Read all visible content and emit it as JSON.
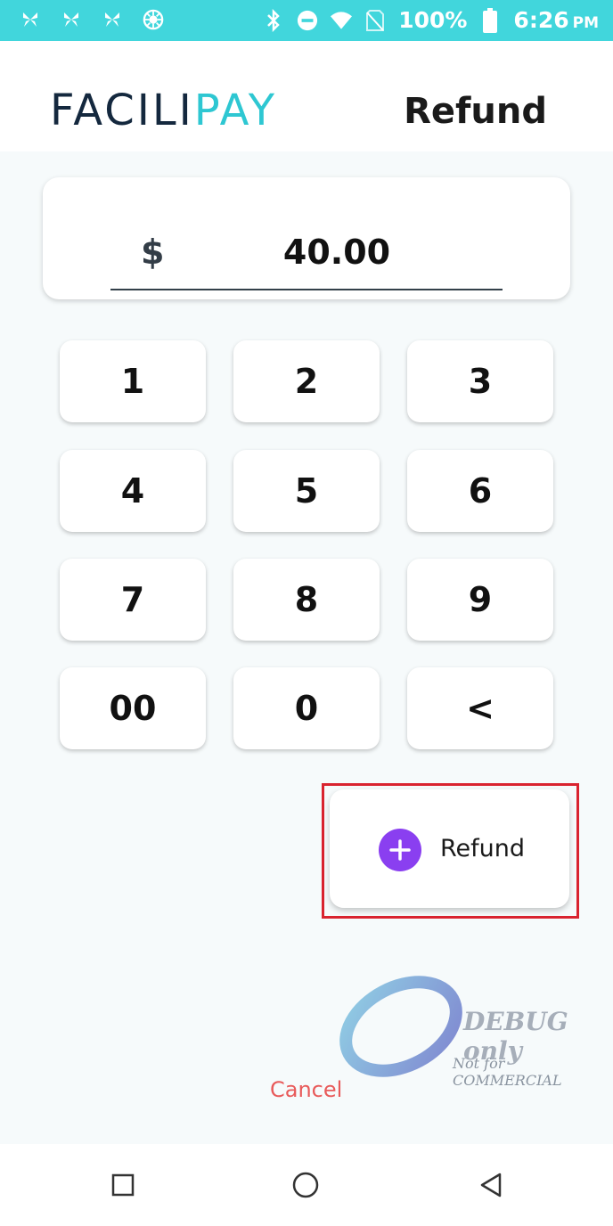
{
  "status_bar": {
    "battery": "100%",
    "time": "6:26",
    "ampm": "PM",
    "left_icons": [
      "butterfly-icon",
      "butterfly-icon",
      "butterfly-icon",
      "aperture-icon"
    ],
    "right_icons": [
      "bluetooth-icon",
      "do-not-disturb-icon",
      "wifi-icon",
      "no-sim-icon",
      "battery-icon"
    ],
    "bg_color": "#41d6dc"
  },
  "header": {
    "logo_part1": "FACILI",
    "logo_part2": "PAY",
    "title": "Refund"
  },
  "amount": {
    "currency": "$",
    "value": "40.00"
  },
  "keypad": [
    "1",
    "2",
    "3",
    "4",
    "5",
    "6",
    "7",
    "8",
    "9",
    "00",
    "0",
    "<"
  ],
  "refund_button": {
    "icon": "plus-icon",
    "label": "Refund",
    "accent": "#8a3ff0"
  },
  "cancel_label": "Cancel",
  "watermark": {
    "line1": "DEBUG only",
    "line2": "Not for COMMERCIAL"
  },
  "nav": [
    "recents-icon",
    "home-icon",
    "back-icon"
  ]
}
